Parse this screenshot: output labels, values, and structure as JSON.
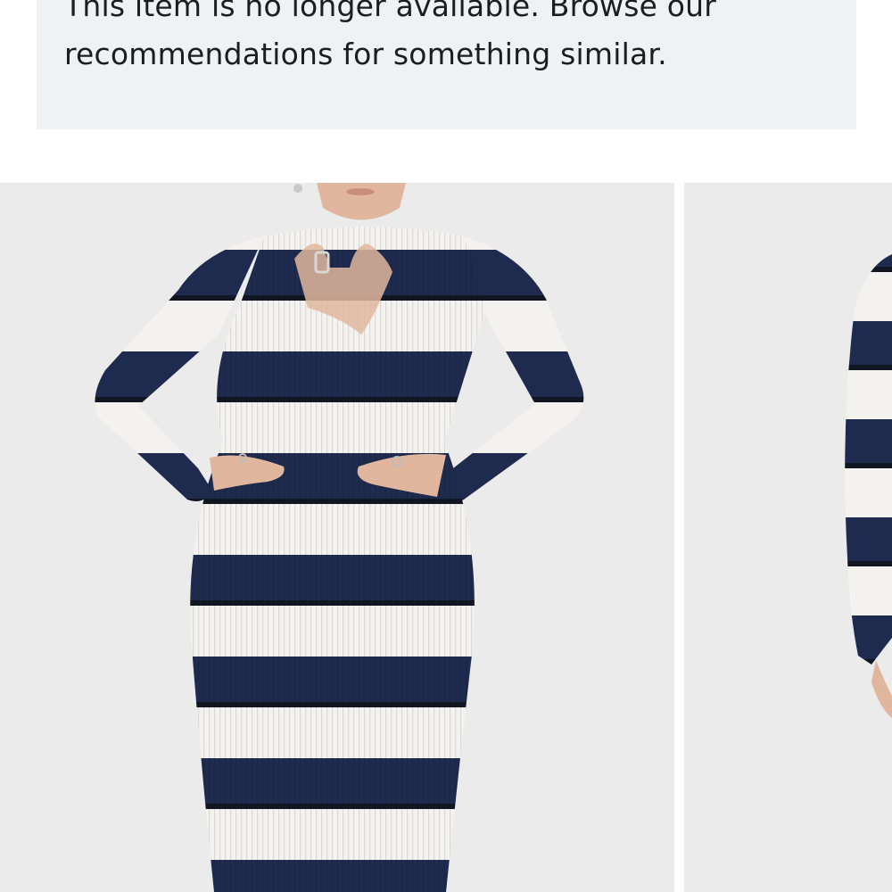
{
  "notice": {
    "line1": "This item is no longer available. Browse our",
    "line2": "recommendations for something similar."
  },
  "gallery": {
    "images": [
      {
        "alt": "",
        "icon": "product-photo-front"
      },
      {
        "alt": "",
        "icon": "product-photo-side"
      }
    ]
  },
  "colors": {
    "notice_bg": "#eef2f3",
    "photo_bg": "#ebebeb",
    "navy": "#1e2a4e",
    "cream": "#f3f2ee",
    "skin": "#e0b79e"
  }
}
